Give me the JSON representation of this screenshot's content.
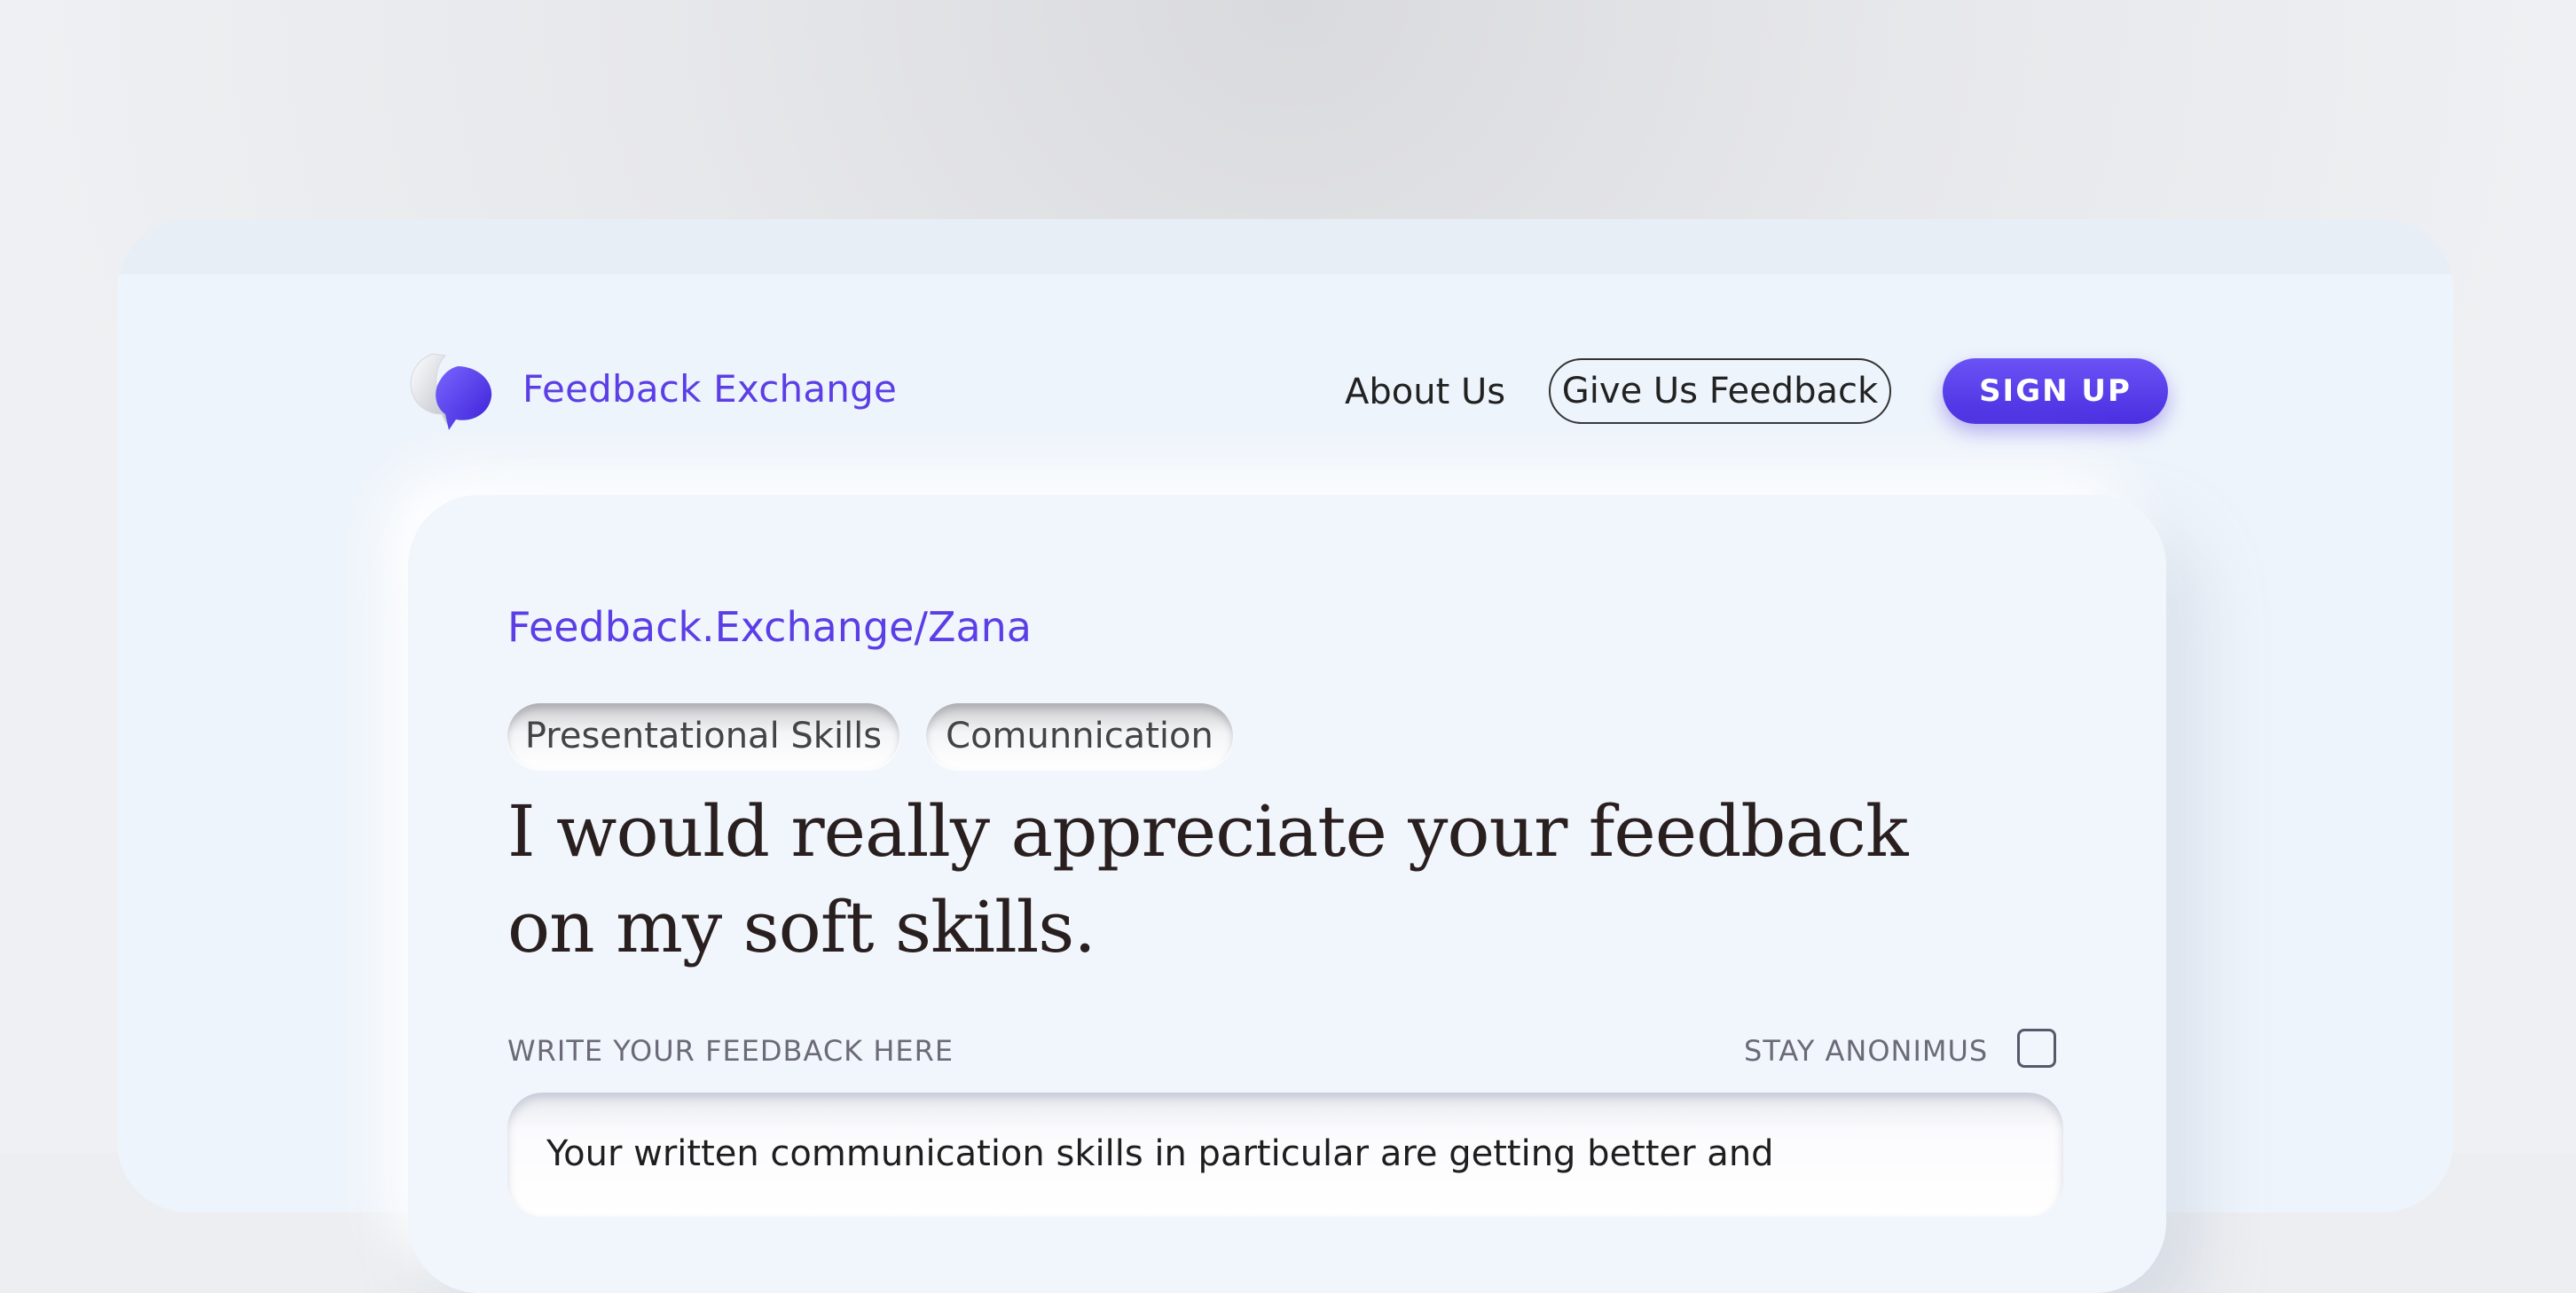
{
  "header": {
    "brand_name": "Feedback Exchange",
    "nav_about": "About Us",
    "nav_give_feedback": "Give Us Feedback",
    "signup_label": "SIGN UP"
  },
  "card": {
    "profile_link": "Feedback.Exchange/Zana",
    "tags": [
      "Presentational Skills",
      "Comunnication"
    ],
    "headline": "I would really appreciate your feedback on my soft skills.",
    "write_label": "WRITE YOUR FEEDBACK HERE",
    "anonymous_label": "STAY ANONIMUS",
    "anonymous_checked": false,
    "feedback_text": "Your written communication skills in particular are getting better and"
  },
  "colors": {
    "accent": "#5b3ee6",
    "signup_gradient_start": "#6a52f5",
    "signup_gradient_end": "#4a2fe0",
    "headline_text": "#2a1f1f",
    "card_bg": "#f1f6fd"
  },
  "icons": {
    "logo": "speech-bubbles-logo-icon",
    "checkbox": "checkbox-icon"
  }
}
